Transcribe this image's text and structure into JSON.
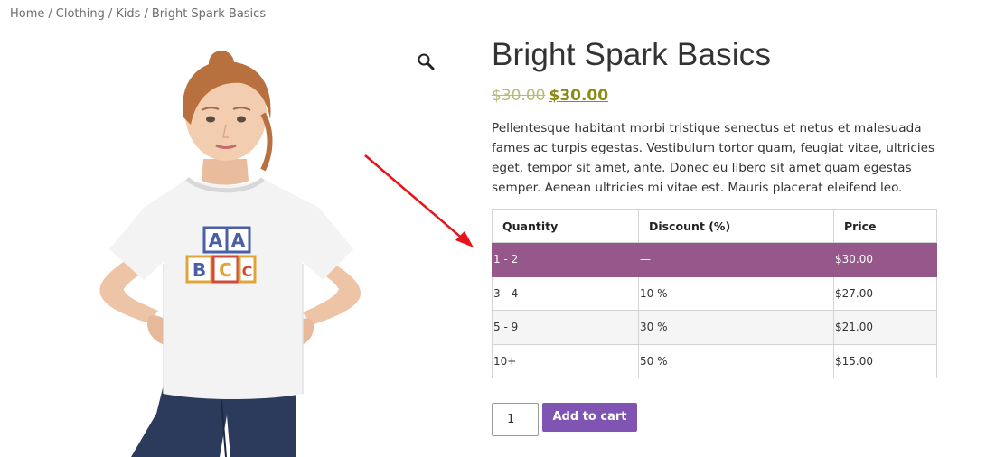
{
  "breadcrumb": {
    "items": [
      "Home",
      "Clothing",
      "Kids",
      "Bright Spark Basics"
    ],
    "separator": "/"
  },
  "product": {
    "title": "Bright Spark Basics",
    "price_old": "$30.00",
    "price_new": "$30.00",
    "description": "Pellentesque habitant morbi tristique senectus et netus et malesuada fames ac turpis egestas. Vestibulum tortor quam, feugiat vitae, ultricies eget, tempor sit amet, ante. Donec eu libero sit amet quam egestas semper. Aenean ultricies mi vitae est. Mauris placerat eleifend leo.",
    "shirt_print_top": [
      "A",
      "A"
    ],
    "shirt_print_bottom": [
      "B",
      "C",
      "C"
    ]
  },
  "discount_table": {
    "headers": [
      "Quantity",
      "Discount (%)",
      "Price"
    ],
    "rows": [
      [
        "1 - 2",
        "—",
        "$30.00"
      ],
      [
        "3 - 4",
        "10 %",
        "$27.00"
      ],
      [
        "5 - 9",
        "30 %",
        "$21.00"
      ],
      [
        "10+",
        "50 %",
        "$15.00"
      ]
    ]
  },
  "cart": {
    "quantity": "1",
    "add_label": "Add to cart"
  },
  "colors": {
    "highlight_row": "#96588a",
    "button": "#7f54b3",
    "price": "#8a8a16",
    "annotation_arrow": "#e8131a"
  },
  "icons": {
    "zoom": "magnifier-icon"
  }
}
